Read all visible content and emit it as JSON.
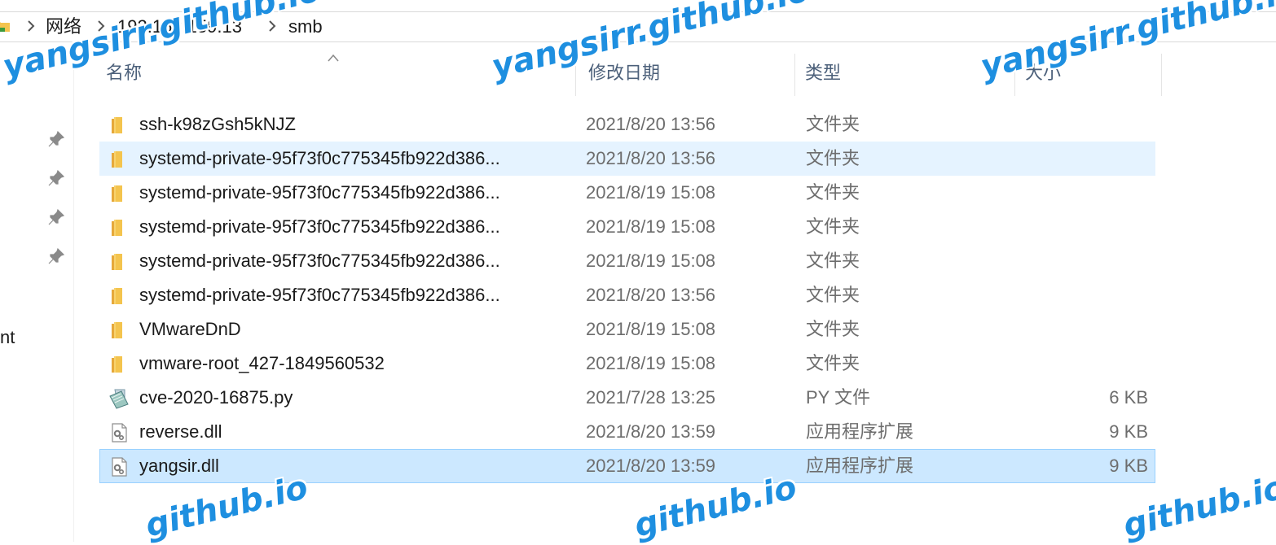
{
  "breadcrumb": {
    "items": [
      "网络",
      "192.168.159.13",
      "smb"
    ]
  },
  "nav": {
    "partial_label": "nt"
  },
  "columns": {
    "name": "名称",
    "date": "修改日期",
    "type": "类型",
    "size": "大小"
  },
  "files": [
    {
      "name": "ssh-k98zGsh5kNJZ",
      "date": "2021/8/20 13:56",
      "type": "文件夹",
      "size": "",
      "icon": "folder-icon"
    },
    {
      "name": "systemd-private-95f73f0c775345fb922d386...",
      "date": "2021/8/20 13:56",
      "type": "文件夹",
      "size": "",
      "icon": "folder-icon"
    },
    {
      "name": "systemd-private-95f73f0c775345fb922d386...",
      "date": "2021/8/19 15:08",
      "type": "文件夹",
      "size": "",
      "icon": "folder-icon"
    },
    {
      "name": "systemd-private-95f73f0c775345fb922d386...",
      "date": "2021/8/19 15:08",
      "type": "文件夹",
      "size": "",
      "icon": "folder-icon"
    },
    {
      "name": "systemd-private-95f73f0c775345fb922d386...",
      "date": "2021/8/19 15:08",
      "type": "文件夹",
      "size": "",
      "icon": "folder-icon"
    },
    {
      "name": "systemd-private-95f73f0c775345fb922d386...",
      "date": "2021/8/20 13:56",
      "type": "文件夹",
      "size": "",
      "icon": "folder-icon"
    },
    {
      "name": "VMwareDnD",
      "date": "2021/8/19 15:08",
      "type": "文件夹",
      "size": "",
      "icon": "folder-icon"
    },
    {
      "name": "vmware-root_427-1849560532",
      "date": "2021/8/19 15:08",
      "type": "文件夹",
      "size": "",
      "icon": "folder-icon"
    },
    {
      "name": "cve-2020-16875.py",
      "date": "2021/7/28 13:25",
      "type": "PY 文件",
      "size": "6 KB",
      "icon": "python-file-icon"
    },
    {
      "name": "reverse.dll",
      "date": "2021/8/20 13:59",
      "type": "应用程序扩展",
      "size": "9 KB",
      "icon": "dll-file-icon"
    },
    {
      "name": "yangsir.dll",
      "date": "2021/8/20 13:59",
      "type": "应用程序扩展",
      "size": "9 KB",
      "icon": "dll-file-icon"
    }
  ],
  "hovered_row": 1,
  "selected_row": 10,
  "watermark": {
    "text_full": "yangsirr.github.io",
    "text_partial": "github.io"
  },
  "colors": {
    "hover": "#e5f3ff",
    "selected": "#cce8ff",
    "selected_border": "#99d1ff",
    "folder": "#f4c44e",
    "watermark": "#1e8fe0"
  }
}
